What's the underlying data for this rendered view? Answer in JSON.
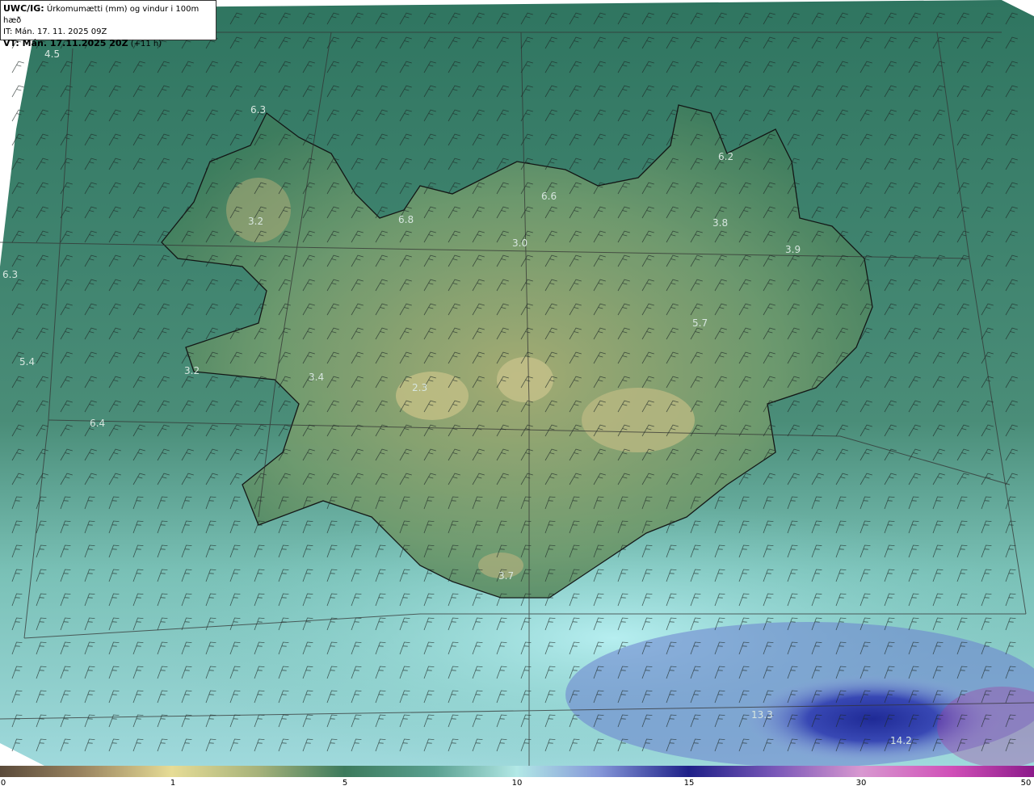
{
  "header": {
    "model": "UWC/IG:",
    "description": "Úrkomumætti (mm) og vindur i 100m hæð",
    "init_time": "IT: Mán. 17. 11. 2025 09Z",
    "valid_time_bold": "VT: Mán. 17.11.2025 20Z",
    "valid_offset": "(+11 h)"
  },
  "colors": {
    "land_dark": "#3c7a5c",
    "land_light": "#b5b77a",
    "sea": "#3f7f67",
    "sea_light": "#a8e4e2",
    "heavy": "#2a2e9a",
    "coast": "#111111",
    "barb": "#222222"
  },
  "map_values": [
    {
      "id": "v1",
      "text": "4.5"
    },
    {
      "id": "v2",
      "text": "6.3"
    },
    {
      "id": "v3",
      "text": "6.2"
    },
    {
      "id": "v4",
      "text": "6.6"
    },
    {
      "id": "v5",
      "text": "3.2"
    },
    {
      "id": "v6",
      "text": "6.8"
    },
    {
      "id": "v7",
      "text": "3.0"
    },
    {
      "id": "v8",
      "text": "3.8"
    },
    {
      "id": "v9",
      "text": "3.9"
    },
    {
      "id": "v10",
      "text": "6.3"
    },
    {
      "id": "v11",
      "text": "5.7"
    },
    {
      "id": "v12",
      "text": "5.4"
    },
    {
      "id": "v13",
      "text": "3.2"
    },
    {
      "id": "v14",
      "text": "3.4"
    },
    {
      "id": "v15",
      "text": "2.3"
    },
    {
      "id": "v16",
      "text": "6.4"
    },
    {
      "id": "v17",
      "text": "3.7"
    },
    {
      "id": "v18",
      "text": "13.3"
    },
    {
      "id": "v19",
      "text": "14.2"
    }
  ],
  "colorbar": {
    "ticks": [
      "0",
      "1",
      "5",
      "10",
      "15",
      "30",
      "50"
    ]
  }
}
